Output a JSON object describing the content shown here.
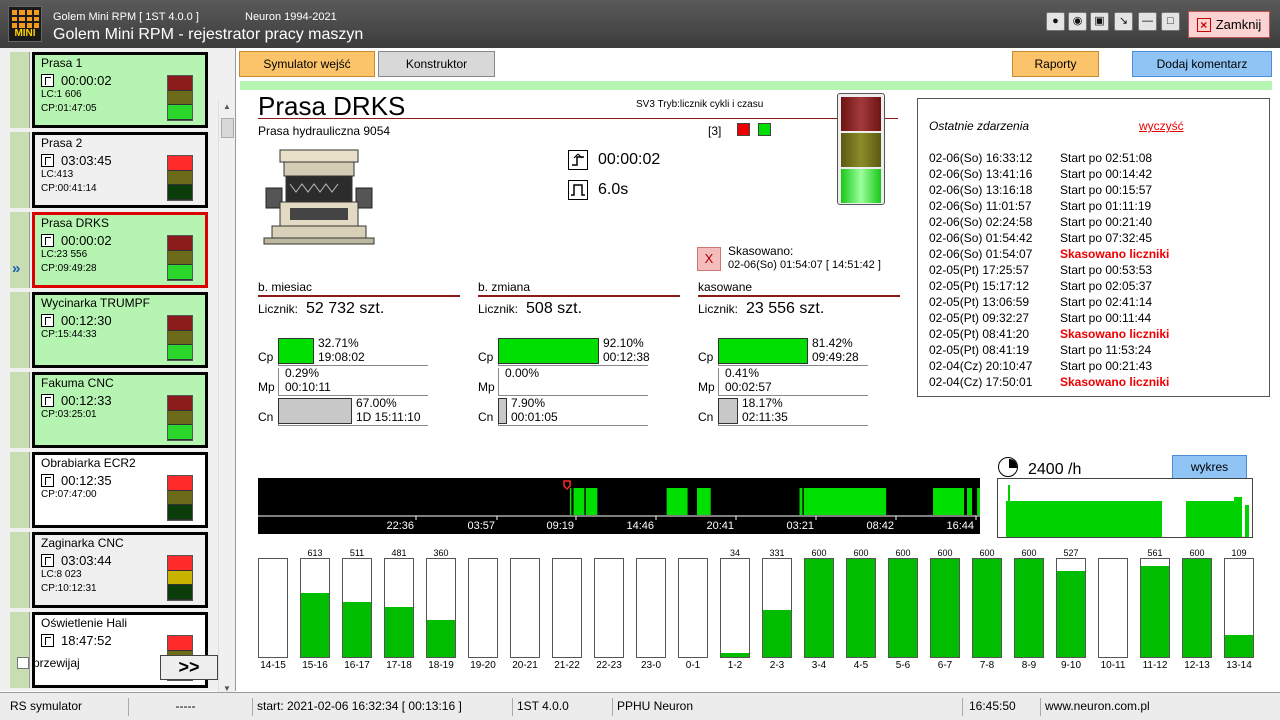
{
  "window": {
    "version_line": "Golem Mini RPM  [ 1ST 4.0.0 ]",
    "copyright": "Neuron 1994-2021",
    "title": "Golem Mini RPM - rejestrator pracy maszyn",
    "logo_text": "MINI",
    "close_label": "Zamknij"
  },
  "toolbar": {
    "sim_label": "Symulator wejść",
    "constructor_label": "Konstruktor",
    "reports_label": "Raporty",
    "comment_label": "Dodaj komentarz"
  },
  "machines": [
    {
      "name": "Prasa 1",
      "time": "00:00:02",
      "lc": "LC:1 606",
      "cp": "CP:01:47:05",
      "state": "green",
      "lamp": [
        "#8b1a1a",
        "#6b6b1a",
        "#2ad62a"
      ]
    },
    {
      "name": "Prasa 2",
      "time": "03:03:45",
      "lc": "LC:413",
      "cp": "CP:00:41:14",
      "state": "gray",
      "lamp": [
        "#ff2a2a",
        "#6b6b1a",
        "#0b3d0b"
      ]
    },
    {
      "name": "Prasa DRKS",
      "time": "00:00:02",
      "lc": "LC:23 556",
      "cp": "CP:09:49:28",
      "state": "green",
      "selected": true,
      "lamp": [
        "#8b1a1a",
        "#6b6b1a",
        "#2ad62a"
      ]
    },
    {
      "name": "Wycinarka TRUMPF",
      "time": "00:12:30",
      "lc": "",
      "cp": "CP:15:44:33",
      "state": "green",
      "lamp": [
        "#8b1a1a",
        "#6b6b1a",
        "#2ad62a"
      ]
    },
    {
      "name": "Fakuma CNC",
      "time": "00:12:33",
      "lc": "",
      "cp": "CP:03:25:01",
      "state": "green",
      "lamp": [
        "#8b1a1a",
        "#6b6b1a",
        "#2ad62a"
      ]
    },
    {
      "name": "Obrabiarka ECR2",
      "time": "00:12:35",
      "lc": "",
      "cp": "CP:07:47:00",
      "state": "white",
      "lamp": [
        "#ff2a2a",
        "#6b6b1a",
        "#0b3d0b"
      ]
    },
    {
      "name": "Zaginarka CNC",
      "time": "03:03:44",
      "lc": "LC:8 023",
      "cp": "CP:10:12:31",
      "state": "gray",
      "lamp": [
        "#ff2a2a",
        "#c8b400",
        "#0b3d0b"
      ]
    },
    {
      "name": "Oświetlenie Hali",
      "time": "18:47:52",
      "lc": "",
      "cp": "",
      "state": "white",
      "lamp": [
        "#ff2a2a",
        "#6b6b1a",
        "#0b3d0b"
      ]
    }
  ],
  "left_footer": {
    "rewind_label": "przewijaj",
    "next_label": ">>"
  },
  "machine": {
    "title": "Prasa DRKS",
    "subtitle": "Prasa hydrauliczna 9054",
    "mode": "SV3 Tryb:licznik cykli i czasu",
    "count": "[3]",
    "time1": "00:00:02",
    "time2": "6.0s",
    "reset_label": "Skasowano:",
    "reset_value": "02-06(So) 01:54:07  [ 14:51:42 ]",
    "reset_btn": "X"
  },
  "sections": [
    {
      "head": "b. miesiac",
      "licz_label": "Licznik:",
      "licz": "52 732 szt.",
      "rows": [
        {
          "lbl": "Cp",
          "pct": "32.71%",
          "time": "19:08:02",
          "fill": 0.3271,
          "color": "#00e000"
        },
        {
          "lbl": "Mp",
          "pct": "0.29%",
          "time": "00:10:11",
          "fill": 0.0029,
          "color": "#ffffff"
        },
        {
          "lbl": "Cn",
          "pct": "67.00%",
          "time": "1D 15:11:10",
          "fill": 0.67,
          "color": "#c8c8c8"
        }
      ]
    },
    {
      "head": "b. zmiana",
      "licz_label": "Licznik:",
      "licz": "508 szt.",
      "rows": [
        {
          "lbl": "Cp",
          "pct": "92.10%",
          "time": "00:12:38",
          "fill": 0.921,
          "color": "#00e000"
        },
        {
          "lbl": "Mp",
          "pct": "0.00%",
          "time": "",
          "fill": 0,
          "color": "#ffffff"
        },
        {
          "lbl": "Cn",
          "pct": "7.90%",
          "time": "00:01:05",
          "fill": 0.079,
          "color": "#c8c8c8"
        }
      ]
    },
    {
      "head": "kasowane",
      "licz_label": "Licznik:",
      "licz": "23 556 szt.",
      "rows": [
        {
          "lbl": "Cp",
          "pct": "81.42%",
          "time": "09:49:28",
          "fill": 0.8142,
          "color": "#00e000"
        },
        {
          "lbl": "Mp",
          "pct": "0.41%",
          "time": "00:02:57",
          "fill": 0.0041,
          "color": "#ffffff"
        },
        {
          "lbl": "Cn",
          "pct": "18.17%",
          "time": "02:11:35",
          "fill": 0.1817,
          "color": "#c8c8c8"
        }
      ]
    }
  ],
  "events": {
    "title": "Ostatnie zdarzenia",
    "clear": "wyczyść",
    "items": [
      {
        "t": "02-06(So) 16:33:12",
        "d": "Start po 02:51:08",
        "red": false
      },
      {
        "t": "02-06(So) 13:41:16",
        "d": "Start po 00:14:42",
        "red": false
      },
      {
        "t": "02-06(So) 13:16:18",
        "d": "Start po 00:15:57",
        "red": false
      },
      {
        "t": "02-06(So) 11:01:57",
        "d": "Start po 01:11:19",
        "red": false
      },
      {
        "t": "02-06(So) 02:24:58",
        "d": "Start po 00:21:40",
        "red": false
      },
      {
        "t": "02-06(So) 01:54:42",
        "d": "Start po 07:32:45",
        "red": false
      },
      {
        "t": "02-06(So) 01:54:07",
        "d": "Skasowano liczniki",
        "red": true
      },
      {
        "t": "02-05(Pt) 17:25:57",
        "d": "Start po 00:53:53",
        "red": false
      },
      {
        "t": "02-05(Pt) 15:17:12",
        "d": "Start po 02:05:37",
        "red": false
      },
      {
        "t": "02-05(Pt) 13:06:59",
        "d": "Start po 02:41:14",
        "red": false
      },
      {
        "t": "02-05(Pt) 09:32:27",
        "d": "Start po 00:11:44",
        "red": false
      },
      {
        "t": "02-05(Pt) 08:41:20",
        "d": "Skasowano liczniki",
        "red": true
      },
      {
        "t": "02-05(Pt) 08:41:19",
        "d": "Start po 11:53:24",
        "red": false
      },
      {
        "t": "02-04(Cz) 20:10:47",
        "d": "Start po 00:21:43",
        "red": false
      },
      {
        "t": "02-04(Cz) 17:50:01",
        "d": "Skasowano liczniki",
        "red": true
      }
    ]
  },
  "timeline": {
    "ticks": [
      "22:36",
      "03:57",
      "09:19",
      "14:46",
      "20:41",
      "03:21",
      "08:42",
      "16:44"
    ],
    "segments": [
      [
        0.432,
        0.434
      ],
      [
        0.437,
        0.452
      ],
      [
        0.454,
        0.47
      ],
      [
        0.566,
        0.595
      ],
      [
        0.608,
        0.627
      ],
      [
        0.75,
        0.754
      ],
      [
        0.756,
        0.87
      ],
      [
        0.935,
        0.978
      ],
      [
        0.982,
        0.989
      ],
      [
        0.996,
        1.0
      ]
    ],
    "marker": 0.428
  },
  "rate": {
    "value": "2400 /h",
    "btn": "wykres"
  },
  "hours": [
    {
      "l": "14-15",
      "v": "",
      "f": 0
    },
    {
      "l": "15-16",
      "v": "613",
      "f": 0.65
    },
    {
      "l": "16-17",
      "v": "511",
      "f": 0.56
    },
    {
      "l": "17-18",
      "v": "481",
      "f": 0.51
    },
    {
      "l": "18-19",
      "v": "360",
      "f": 0.38
    },
    {
      "l": "19-20",
      "v": "",
      "f": 0
    },
    {
      "l": "20-21",
      "v": "",
      "f": 0
    },
    {
      "l": "21-22",
      "v": "",
      "f": 0
    },
    {
      "l": "22-23",
      "v": "",
      "f": 0
    },
    {
      "l": "23-0",
      "v": "",
      "f": 0
    },
    {
      "l": "0-1",
      "v": "",
      "f": 0
    },
    {
      "l": "1-2",
      "v": "34",
      "f": 0.04
    },
    {
      "l": "2-3",
      "v": "331",
      "f": 0.48
    },
    {
      "l": "3-4",
      "v": "600",
      "f": 1
    },
    {
      "l": "4-5",
      "v": "600",
      "f": 1
    },
    {
      "l": "5-6",
      "v": "600",
      "f": 1
    },
    {
      "l": "6-7",
      "v": "600",
      "f": 1
    },
    {
      "l": "7-8",
      "v": "600",
      "f": 1
    },
    {
      "l": "8-9",
      "v": "600",
      "f": 1
    },
    {
      "l": "9-10",
      "v": "527",
      "f": 0.88
    },
    {
      "l": "10-11",
      "v": "",
      "f": 0
    },
    {
      "l": "11-12",
      "v": "561",
      "f": 0.93
    },
    {
      "l": "12-13",
      "v": "600",
      "f": 1
    },
    {
      "l": "13-14",
      "v": "109",
      "f": 0.22
    }
  ],
  "status": {
    "s1": "RS symulator",
    "s2": "-----",
    "s3": "start: 2021-02-06 16:32:34 [ 00:13:16 ]",
    "s4": "1ST 4.0.0",
    "s5": "PPHU Neuron",
    "s6": "16:45:50",
    "s7": "www.neuron.com.pl"
  }
}
